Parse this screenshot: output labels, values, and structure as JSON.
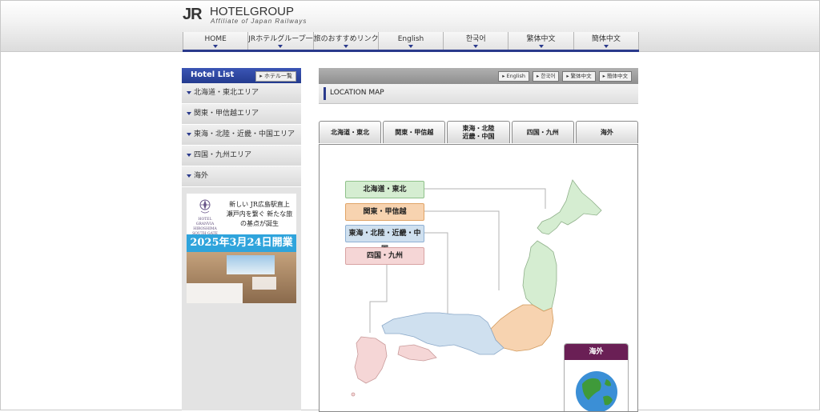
{
  "header": {
    "logo_mark": "JR",
    "logo_name": "HOTELGROUP",
    "logo_sub": "Affiliate of Japan Railways",
    "nav": [
      "HOME",
      "JRホテルグループ一覧",
      "旅のおすすめリンク",
      "English",
      "한국어",
      "繁体中文",
      "簡体中文"
    ]
  },
  "sidebar": {
    "title": "Hotel List",
    "list_button": "ホテル一覧",
    "areas": [
      "北海道・東北エリア",
      "関東・甲信越エリア",
      "東海・北陸・近畿・中国エリア",
      "四国・九州エリア",
      "海外"
    ],
    "banner": {
      "logo_text": "HOTEL GRANVIA HIROSHIMA SOUTH GATE",
      "headline": "新しい JR広島駅直上 瀬戸内を繋ぐ 新たな旅の基点が誕生",
      "date": "2025年3月24日開業"
    }
  },
  "main": {
    "lang_buttons": [
      "English",
      "한국어",
      "繁体中文",
      "簡体中文"
    ],
    "section_title": "LOCATION MAP",
    "tabs": [
      "北海道・東北",
      "関東・甲信越",
      "東海・北陸\n近畿・中国",
      "四国・九州",
      "海外"
    ],
    "regions": [
      "北海道・東北",
      "関東・甲信越",
      "東海・北陸・近畿・中国",
      "四国・九州"
    ],
    "overseas_label": "海外",
    "colors": {
      "hokkaido_tohoku": "#d5edd1",
      "kanto_koshinetsu": "#f7d3b0",
      "tokai_kinki_chugoku": "#cfe0ef",
      "shikoku_kyushu": "#f5d6d6",
      "accent": "#2a3a8c"
    }
  }
}
